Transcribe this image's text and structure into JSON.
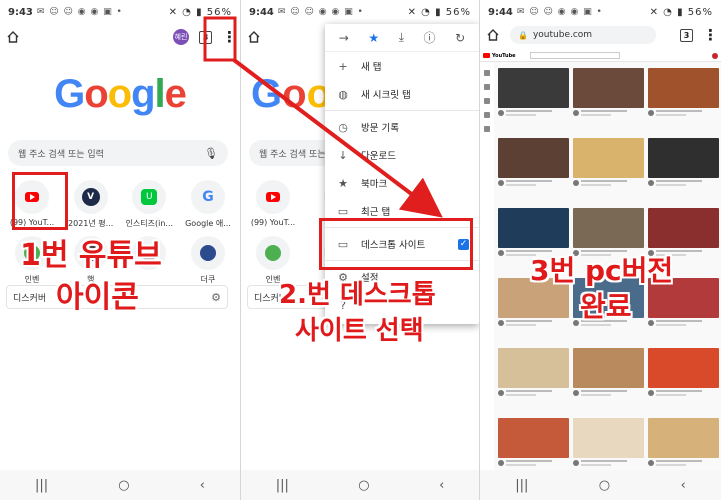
{
  "screen1": {
    "status_time": "9:43",
    "status_right": "56%",
    "avatar_text": "혜린",
    "tab_count": "3",
    "logo_letters": [
      "G",
      "o",
      "o",
      "g",
      "l",
      "e"
    ],
    "search_placeholder": "웹 주소 검색 또는 입력",
    "tiles_row1": [
      {
        "label": "(99) YouT...",
        "glyph": "V"
      },
      {
        "label": "2021년 평...",
        "glyph": "V"
      },
      {
        "label": "인스티즈(in...",
        "glyph": "U"
      },
      {
        "label": "Google 애...",
        "glyph": "G"
      }
    ],
    "tiles_row2": [
      {
        "label": "인벤"
      },
      {
        "label": "행"
      },
      {
        "label": ""
      },
      {
        "label": "더쿠"
      }
    ],
    "discover_label": "디스커버",
    "annotation_line1": "1번 유튜브",
    "annotation_line2": "아이콘"
  },
  "screen2": {
    "status_time": "9:44",
    "status_right": "56%",
    "search_placeholder": "웹 주소 검색 또는 입",
    "tile_labels": [
      "(99) YouT...",
      "2021"
    ],
    "tile_labels_row2": [
      "인벤",
      "행"
    ],
    "discover_label": "디스커버",
    "menu_items": [
      {
        "icon": "+",
        "label": "새 탭"
      },
      {
        "icon": "◍",
        "label": "새 시크릿 탭"
      },
      {
        "icon": "◷",
        "label": "방문 기록"
      },
      {
        "icon": "↓",
        "label": "다운로드"
      },
      {
        "icon": "★",
        "label": "북마크"
      },
      {
        "icon": "▭",
        "label": "최근 탭"
      }
    ],
    "desktop_item": {
      "icon": "▭",
      "label": "데스크톱 사이트",
      "checked": "✓"
    },
    "after_items": [
      {
        "icon": "⚙",
        "label": "설정"
      },
      {
        "icon": "?",
        "label": ""
      }
    ],
    "annotation_line1": "2.번 데스크톱",
    "annotation_line2": "사이트 선택"
  },
  "screen3": {
    "status_time": "9:44",
    "status_right": "56%",
    "url": "youtube.com",
    "tab_count": "3",
    "yt_logo": "YouTube",
    "annotation_line1": "3번 pc버전",
    "annotation_line2": "완료"
  },
  "colors": {
    "annotation_red": "#e0191a",
    "google_blue": "#4285f4",
    "youtube_red": "#ff0000",
    "chrome_blue": "#1a73e8"
  }
}
